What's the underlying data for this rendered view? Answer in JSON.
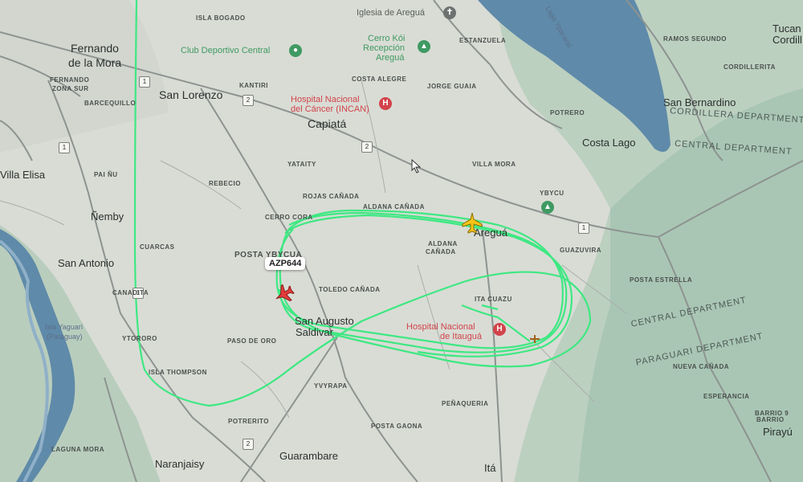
{
  "map": {
    "colors": {
      "land": "#d9dcd5",
      "green_land": "#a9c6b4",
      "water": "#5f8aa9",
      "road": "#8d9390",
      "flight_track": "#3ee882",
      "aircraft_red": "#e33b3b",
      "airport_yellow": "#f5c518",
      "poi_red": "#d2434b",
      "poi_green": "#3f9a62"
    },
    "towns": {
      "fernando": "Fernando",
      "de_la_mora": "de la Mora",
      "san_lorenzo": "San Lorenzo",
      "capiata": "Capiatá",
      "villa_elisa": "Villa Elisa",
      "nemby": "Ñemby",
      "san_antonio": "San Antonio",
      "costa_lago": "Costa Lago",
      "san_bernardino": "San Bernardino",
      "guarambare": "Guarambare",
      "naranjaisy": "Naranjaisy",
      "ita": "Itá",
      "pirayu": "Pirayú",
      "tucan": "Tucan",
      "cordill": "Cordill",
      "augusto": "San Augusto",
      "saldivar": "Saldivar",
      "aregua": "Areguá"
    },
    "small_labels": {
      "isla_bogado": "ISLA BOGADO",
      "fernando_zona_sur": "FERNANDO",
      "zona_sur": "ZONA SUR",
      "barcequillo": "BARCEQUILLO",
      "kantiri": "KANTIRI",
      "costa_alegre": "COSTA ALEGRE",
      "jorge_cuaia": "JORGE GUAIA",
      "estanzuela": "ESTANZUELA",
      "pai_nu": "PAI ÑU",
      "yataity": "YATAITY",
      "rebecio": "REBECIO",
      "rojas_canada": "ROJAS CAÑADA",
      "aldana_canada": "ALDANA CAÑADA",
      "cerro_corra": "CERRO CORA",
      "cuarcas": "CUARCAS",
      "posta_ybycua": "POSTA YBYCUA",
      "canadita": "CANADITA",
      "toledo_canada": "TOLEDO CAÑADA",
      "ytororo": "YTORORO",
      "paso_de_oro": "PASO DE ORO",
      "isla_thompson": "ISLA THOMPSON",
      "potrerito": "POTRERITO",
      "ybyrapa": "YVYRAPA",
      "penaqueria": "PEÑAQUERIA",
      "posta_gaona": "POSTA GAONA",
      "villa_mora": "VILLA MORA",
      "ita_cuazu": "ITA CUAZU",
      "aldana_canada2": "ALDANA",
      "canada": "CAÑADA",
      "guazuvira": "GUAZUVIRA",
      "pirayu_area": "BARRIO",
      "cordillerita": "CORDILLERITA",
      "esperancia": "ESPERANCIA",
      "posta_estrella": "POSTA ESTRELLA",
      "ybycu": "YBYCU",
      "ramos_segundo": "RAMOS SEGUNDO",
      "potrero": "POTRERO",
      "barrio_9": "BARRIO 9",
      "laguna_mora": "LAGUNA MORA",
      "nueva_canada": "NUEVA CAÑADA"
    },
    "departments": {
      "cordillera": "CORDILLERA DEPARTMENT",
      "central_top": "CENTRAL DEPARTMENT",
      "central_bottom": "CENTRAL DEPARTMENT",
      "paraguari": "PARAGUARI DEPARTMENT"
    },
    "water_labels": {
      "lake": "Lago Ypacaraí",
      "isla_yacare": "Isla Yaguarí",
      "paraguay": "(Paraguay)"
    },
    "pois": {
      "iglesia": "Iglesia de Areguá",
      "club": "Club Deportivo Central",
      "cerro_koi": "Cerro Kói",
      "recepcion": "Recepción",
      "aregua_poi": "Areguá",
      "hospital_cancer_1": "Hospital Nacional",
      "hospital_cancer_2": "del Cáncer (INCAN)",
      "hospital_itaugua_1": "Hospital Nacional",
      "hospital_itaugua_2": "de Itauguá"
    },
    "route_shields": [
      "1",
      "1",
      "2",
      "2",
      "1",
      "1",
      "2"
    ],
    "flight": {
      "callsign": "AZP644"
    }
  }
}
